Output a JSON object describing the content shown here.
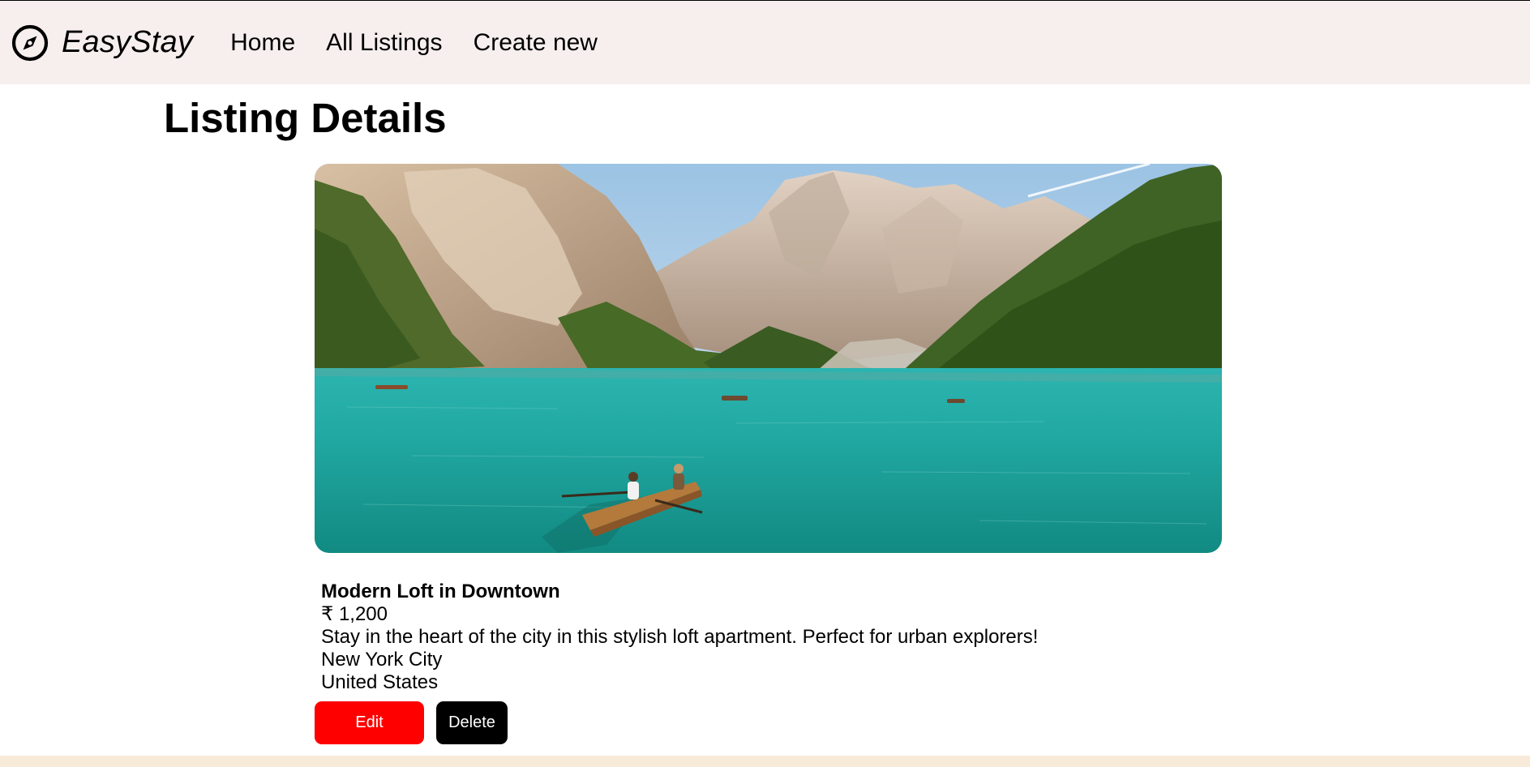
{
  "navbar": {
    "brand_icon": "compass-icon",
    "brand_name": "EasyStay",
    "links": [
      {
        "label": "Home"
      },
      {
        "label": "All Listings"
      },
      {
        "label": "Create new"
      }
    ],
    "background": "#f6efee"
  },
  "page": {
    "title": "Listing Details"
  },
  "listing": {
    "image": "mountain-lake-with-boats",
    "title": "Modern Loft in Downtown",
    "price": "₹ 1,200",
    "description": "Stay in the heart of the city in this stylish loft apartment. Perfect for urban explorers!",
    "location": "New York City",
    "country": "United States"
  },
  "actions": {
    "edit_label": "Edit",
    "delete_label": "Delete",
    "edit_color": "#fe0000",
    "delete_color": "#000000"
  },
  "footer": {
    "background": "#f8ead9"
  }
}
